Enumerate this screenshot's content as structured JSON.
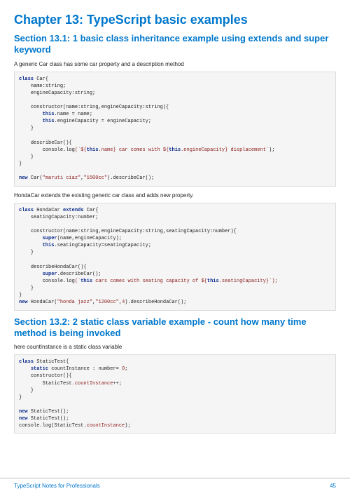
{
  "chapter_title": "Chapter 13: TypeScript basic examples",
  "section1": {
    "heading": "Section 13.1: 1 basic class inheritance example using extends and super keyword",
    "intro1": "A generic Car class has some car property and a description method",
    "intro2": "HondaCar extends the existing generic car class and adds new property."
  },
  "section2": {
    "heading": "Section 13.2: 2 static class variable example - count how many time method is being invoked",
    "intro": "here countInstance is a static class variable"
  },
  "footer": {
    "left": "TypeScript Notes for Professionals",
    "page": "45"
  },
  "code1": {
    "class_decl": "class",
    "class_name": "Car{",
    "prop_name": "name",
    "type_string": "string",
    "prop_engine": "engineCapacity",
    "ctor": "constructor",
    "ctor_params": "(name:string,engineCapacity:string){",
    "this": "this",
    "dot_name": ".name",
    "eq_name": " = name;",
    "dot_engine": ".engineCapacity",
    "eq_engine": " = engineCapacity;",
    "desc_method": "describeCar",
    "console_log": "console.log",
    "tmpl_open": "(`${",
    "tmpl_mid1": ".name}",
    "tmpl_txt1": " car comes with ",
    "tmpl_mid2": "${",
    "tmpl_mid3": ".engineCapacity}",
    "tmpl_txt2": " displacement`",
    "tmpl_close": ");",
    "new": "new",
    "new_call": " Car(",
    "arg1": "\"maruti ciaz\"",
    "comma": ",",
    "arg2": "\"1500cc\"",
    "tail": ").describeCar();"
  },
  "code2": {
    "class_decl": "class",
    "class_name": " HondaCar ",
    "extends": "extends",
    "parent": " Car{",
    "seat_prop": "seatingCapacity",
    "type_num": "number",
    "ctor": "constructor",
    "ctor_params": "(name:string,engineCapacity:string,seatingCapacity:number){",
    "super": "super",
    "super_args": "(name,engineCapacity);",
    "this": "this",
    "dot_seat": ".seatingCapacity",
    "eq_seat": "=seatingCapacity;",
    "desc_method": "describeHondaCar",
    "super_desc": ".describeCar();",
    "console_log": "console.log",
    "tmpl_open": "(`",
    "tmpl_txt1": "this",
    "tmpl_txt2": " cars comes with seating capacity of ",
    "tmpl_mid": "${",
    "tmpl_close": ".seatingCapacity}`);",
    "new": "new",
    "new_call": " HondaCar(",
    "arg1": "\"honda jazz\"",
    "arg2": "\"1200cc\"",
    "arg3": "4",
    "tail": ").describeHondaCar();"
  },
  "code3": {
    "class_decl": "class",
    "class_name": " StaticTest{",
    "static": "static",
    "count": " countInstance ",
    "colon_type": ": number= ",
    "zero": "0",
    "ctor": "constructor",
    "ctor_params": "(){",
    "inc": "StaticTest",
    "inc_prop": ".countInstance",
    "inc_op": "++;",
    "new": "new",
    "newcall": " StaticTest();",
    "console_log": "console.log",
    "log_arg1": "(StaticTest",
    "log_arg2": ".countInstance",
    "log_close": ");"
  }
}
